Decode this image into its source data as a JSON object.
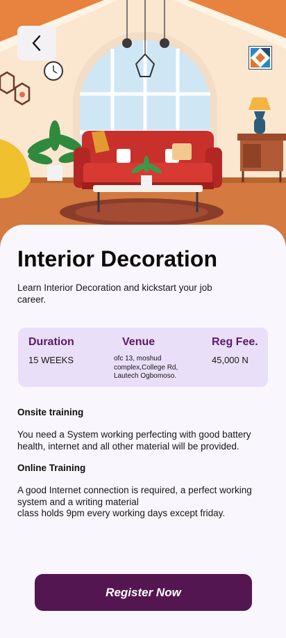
{
  "header": {
    "back_icon": "chevron-left-icon",
    "logo_icon": "brand-logo-icon"
  },
  "course": {
    "title": "Interior Decoration",
    "subtitle": "Learn Interior Decoration and kickstart your job career."
  },
  "info": {
    "duration": {
      "label": "Duration",
      "value": "15 WEEKS"
    },
    "venue": {
      "label": "Venue",
      "value": "ofc 13, moshud complex,College Rd, Lautech Ogbomoso."
    },
    "fee": {
      "label": "Reg Fee.",
      "value": "45,000 N"
    }
  },
  "sections": {
    "onsite": {
      "title": "Onsite training",
      "text": "You need a System working perfecting with good battery health, internet and all other material will be provided."
    },
    "online": {
      "title": "Online Training",
      "text": "A good Internet connection is required, a perfect working system and a writing material\nclass holds 9pm every working days except friday."
    }
  },
  "cta": {
    "label": "Register Now"
  },
  "colors": {
    "accent": "#541651",
    "info_bg": "#e9dff9",
    "heading": "#5b1a63"
  }
}
